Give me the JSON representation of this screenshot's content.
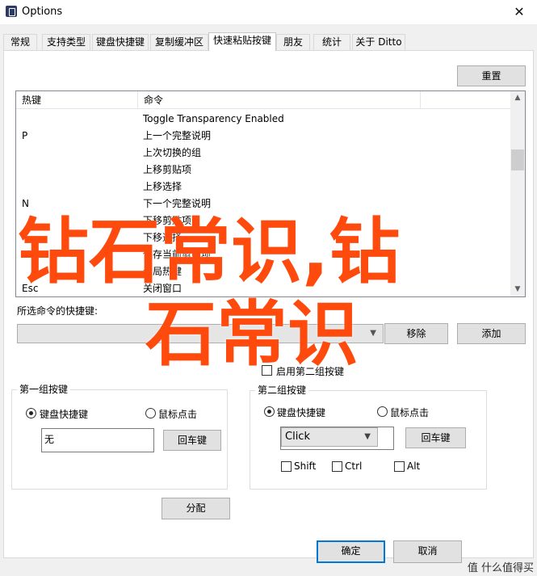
{
  "window": {
    "title": "Options",
    "close_glyph": "✕"
  },
  "tabs": [
    {
      "label": "常规",
      "active": false
    },
    {
      "label": "支持类型",
      "active": false
    },
    {
      "label": "键盘快捷键",
      "active": false
    },
    {
      "label": "复制缓冲区",
      "active": false
    },
    {
      "label": "快速粘贴按键",
      "active": true
    },
    {
      "label": "朋友",
      "active": false
    },
    {
      "label": "统计",
      "active": false
    },
    {
      "label": "关于 Ditto",
      "active": false
    }
  ],
  "reset_button": "重置",
  "list": {
    "headers": {
      "hotkey": "热键",
      "command": "命令"
    },
    "rows": [
      {
        "hotkey": "",
        "command": "Toggle Transparency Enabled"
      },
      {
        "hotkey": "P",
        "command": "上一个完整说明"
      },
      {
        "hotkey": "",
        "command": "上次切换的组"
      },
      {
        "hotkey": "",
        "command": "上移剪贴项"
      },
      {
        "hotkey": "",
        "command": "上移选择"
      },
      {
        "hotkey": "N",
        "command": "下一个完整说明"
      },
      {
        "hotkey": "",
        "command": "下移剪贴项"
      },
      {
        "hotkey": "",
        "command": "下移选择"
      },
      {
        "hotkey": "",
        "command": "保存当前剪贴项"
      },
      {
        "hotkey": "",
        "command": "全局热键"
      },
      {
        "hotkey": "Esc",
        "command": "关闭窗口"
      }
    ]
  },
  "shortcut_label": "所选命令的快捷键:",
  "remove_button": "移除",
  "add_button": "添加",
  "enable_second_label": "启用第二组按键",
  "group1": {
    "title": "第一组按键",
    "radio_keyboard": "键盘快捷键",
    "radio_mouse": "鼠标点击",
    "hotkey_value": "无",
    "enter_button": "回车键"
  },
  "group2": {
    "title": "第二组按键",
    "radio_keyboard": "键盘快捷键",
    "radio_mouse": "鼠标点击",
    "mouse_option": "Click",
    "enter_button": "回车键",
    "mod_shift": "Shift",
    "mod_ctrl": "Ctrl",
    "mod_alt": "Alt"
  },
  "assign_button": "分配",
  "ok_button": "确定",
  "cancel_button": "取消",
  "watermark": {
    "line1": "钻石常识,钻",
    "line2": "石常识",
    "corner": "值 什么值得买"
  }
}
